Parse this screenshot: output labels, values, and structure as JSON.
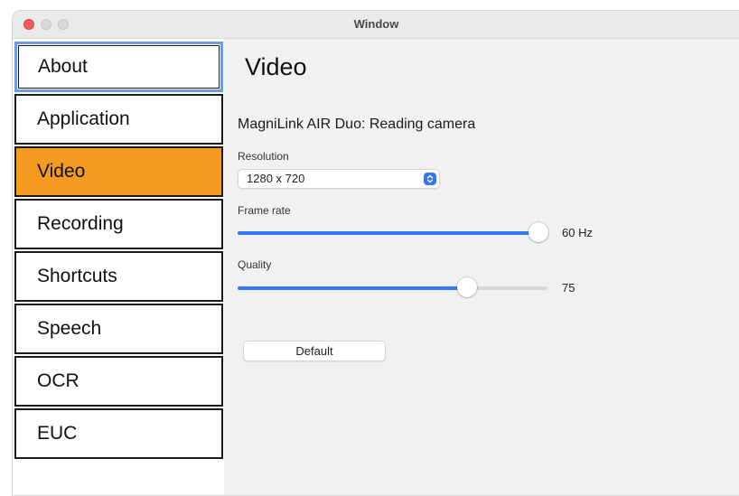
{
  "window": {
    "title": "Window"
  },
  "sidebar": {
    "items": [
      {
        "label": "About",
        "state": "focused"
      },
      {
        "label": "Application",
        "state": "normal"
      },
      {
        "label": "Video",
        "state": "selected"
      },
      {
        "label": "Recording",
        "state": "normal"
      },
      {
        "label": "Shortcuts",
        "state": "normal"
      },
      {
        "label": "Speech",
        "state": "normal"
      },
      {
        "label": "OCR",
        "state": "normal"
      },
      {
        "label": "EUC",
        "state": "normal"
      }
    ],
    "selected_color": "#f39a21",
    "focus_color": "#6f9ae8"
  },
  "content": {
    "title": "Video",
    "device": "MagniLink AIR Duo: Reading camera",
    "resolution": {
      "label": "Resolution",
      "value": "1280 x 720"
    },
    "frame_rate": {
      "label": "Frame rate",
      "value": "60 Hz",
      "fraction": 0.97
    },
    "quality": {
      "label": "Quality",
      "value": "75",
      "fraction": 0.74
    },
    "default_button": "Default",
    "accent_color": "#3478f6"
  }
}
